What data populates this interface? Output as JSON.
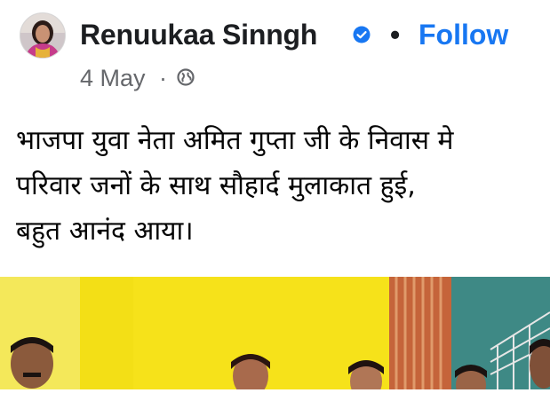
{
  "post": {
    "author": "Renuukaa Sinngh",
    "follow_label": "Follow",
    "separator": "•",
    "date": "4 May",
    "date_separator": "·",
    "text_lines": [
      "भाजपा युवा नेता अमित गुप्ता जी के निवास मे",
      "परिवार जनों के साथ सौहार्द मुलाकात हुई,",
      "बहुत आनंद आया।"
    ]
  },
  "icons": {
    "verified": "verified-badge-icon",
    "privacy": "globe-icon"
  },
  "colors": {
    "link": "#1877f2",
    "name_text": "#1c1e21",
    "meta_text": "#65676b",
    "photo_wall": "#f5e418",
    "photo_wall_right": "#3f8a86"
  }
}
